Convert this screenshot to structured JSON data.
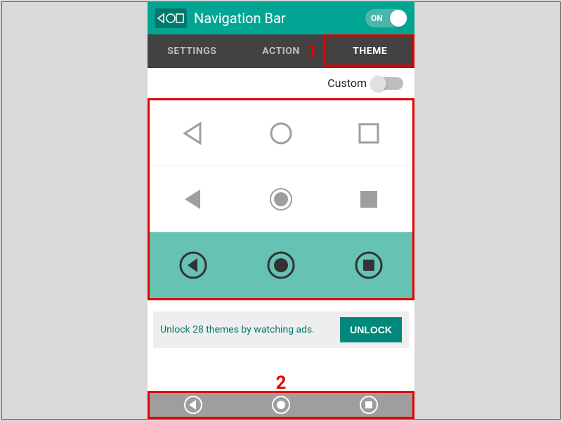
{
  "header": {
    "title": "Navigation Bar",
    "toggle_label": "ON",
    "toggle_on": true
  },
  "tabs": {
    "items": [
      {
        "label": "SETTINGS",
        "active": false
      },
      {
        "label": "ACTION",
        "active": false
      },
      {
        "label": "THEME",
        "active": true
      }
    ]
  },
  "custom": {
    "label": "Custom",
    "enabled": false
  },
  "themes": {
    "rows": [
      {
        "style": "outline",
        "selected": false
      },
      {
        "style": "filled",
        "selected": false
      },
      {
        "style": "circled",
        "selected": true
      }
    ]
  },
  "unlock": {
    "text": "Unlock 28 themes by watching ads.",
    "button": "UNLOCK"
  },
  "annotations": {
    "num1": "1",
    "num2": "2"
  },
  "colors": {
    "accent": "#00a693",
    "accent_dark": "#00796b",
    "highlight": "#e60000"
  }
}
